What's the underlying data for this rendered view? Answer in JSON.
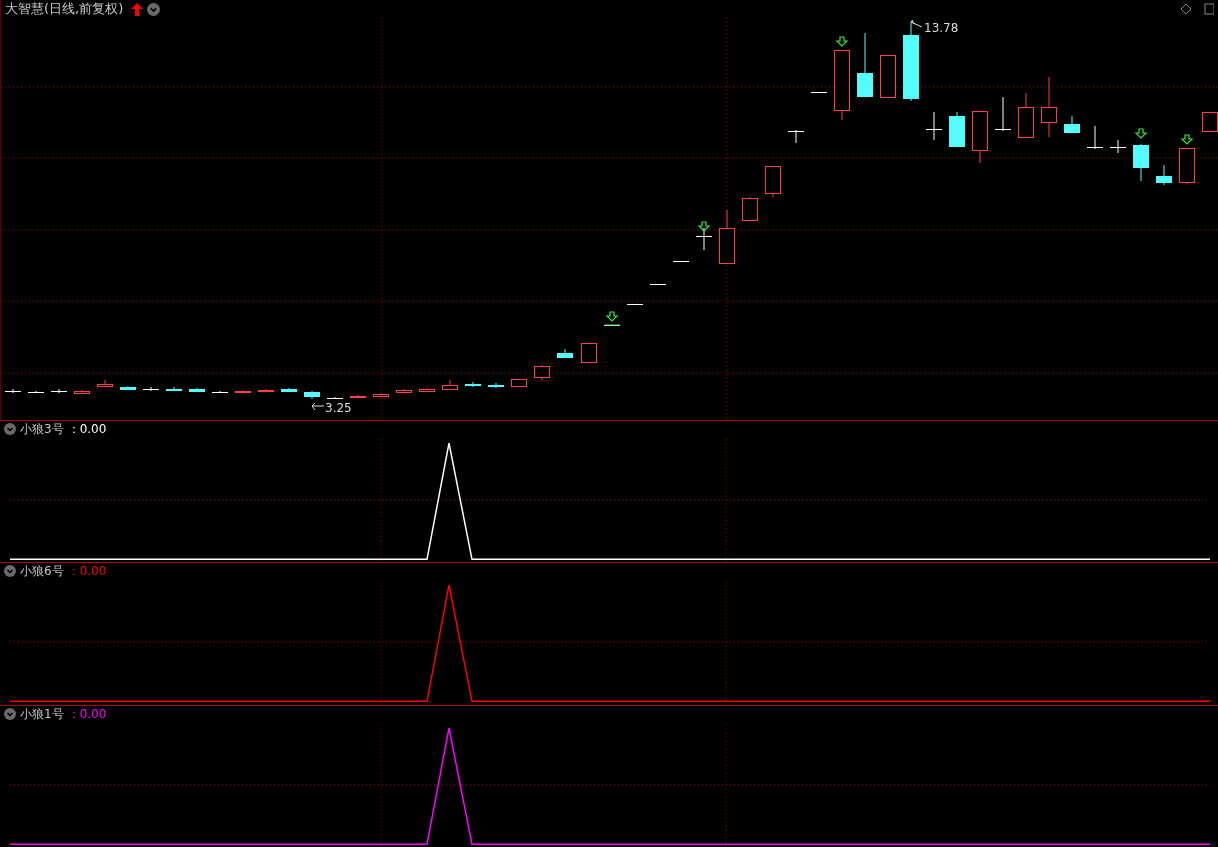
{
  "chart": {
    "title": "大智慧(日线,前复权)",
    "high_label": "13.78",
    "low_label": "3.25"
  },
  "indicators": [
    {
      "name": "小狼3号",
      "value": "：0.00",
      "color": "#ffffff"
    },
    {
      "name": "小狼6号",
      "value": "：0.00",
      "color": "#ff0000"
    },
    {
      "name": "小狼1号",
      "value": "：0.00",
      "color": "#ff00ff"
    }
  ]
}
